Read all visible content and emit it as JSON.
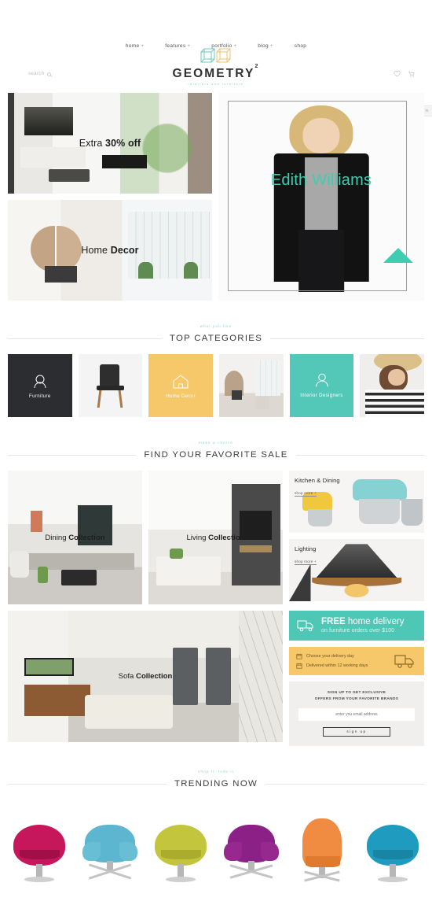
{
  "header": {
    "search_placeholder": "search",
    "brand_name": "GEOMETRY",
    "brand_sup": "2",
    "brand_tagline": "interiors and furniture",
    "icons": {
      "wishlist": "heart-icon",
      "cart": "cart-icon"
    },
    "side_tab_label": "in",
    "nav": [
      {
        "label": "home",
        "caret": "+"
      },
      {
        "label": "features",
        "caret": "+"
      },
      {
        "label": "portfolio",
        "caret": "+"
      },
      {
        "label": "blog",
        "caret": "+"
      },
      {
        "label": "shop",
        "caret": ""
      }
    ]
  },
  "hero": {
    "tile1": {
      "pre": "Extra ",
      "strong": "30% off"
    },
    "tile2": {
      "pre": "Home ",
      "strong": "Decor"
    },
    "feature": {
      "name": "Edith Williams",
      "accent": "#3ecdb0"
    }
  },
  "categories_section": {
    "sub_label": "what you like",
    "title": "TOP CATEGORIES",
    "items": [
      {
        "label": "Furniture",
        "icon": "lamp-icon",
        "style": "dark"
      },
      {
        "label": "",
        "icon": "chair-photo",
        "style": "light"
      },
      {
        "label": "Home Decor",
        "icon": "house-icon",
        "style": "amber"
      },
      {
        "label": "",
        "icon": "room-photo",
        "style": "photo"
      },
      {
        "label": "Interior Designers",
        "icon": "person-icon",
        "style": "teal"
      },
      {
        "label": "",
        "icon": "model-photo",
        "style": "photo"
      }
    ]
  },
  "sale_section": {
    "sub_label": "make a choice",
    "title": "FIND YOUR FAVORITE SALE",
    "tiles": [
      {
        "pre": "Dining ",
        "strong": "Collection"
      },
      {
        "pre": "Living ",
        "strong": "Collection"
      },
      {
        "pre": "Sofa ",
        "strong": "Collection"
      }
    ],
    "promos": [
      {
        "title": "Kitchen & Dining",
        "link": "shop more +"
      },
      {
        "title": "Lighting",
        "link": "shop more +"
      }
    ]
  },
  "delivery": {
    "headline_strong": "FREE",
    "headline_rest": " home delivery",
    "subline": "on furniture orders over $100",
    "truck_icon": "delivery-truck-icon",
    "options": [
      {
        "icon": "calendar-icon",
        "text": "Choose your delivery day"
      },
      {
        "icon": "calendar-icon",
        "text": "Delivered within 12 working days"
      }
    ]
  },
  "newsletter": {
    "line1": "SIGN UP TO GET EXCLUSIVE",
    "line2": "OFFERS FROM YOUR FAVORITE BRANDS",
    "input_placeholder": "enter you email address",
    "input_value": "",
    "button_label": "sign up"
  },
  "trending_section": {
    "sub_label": "shop it, love it",
    "title": "TRENDING NOW",
    "chairs": [
      {
        "name": "ball-chair-magenta",
        "color": "#c7175c"
      },
      {
        "name": "swan-chair-blue",
        "color": "#5cb6cf"
      },
      {
        "name": "ball-chair-olive",
        "color": "#c3c63c"
      },
      {
        "name": "swan-chair-purple",
        "color": "#8b2186"
      },
      {
        "name": "egg-chair-orange",
        "color": "#ef8c42"
      },
      {
        "name": "ball-chair-teal",
        "color": "#1e9bbf"
      }
    ]
  },
  "theme": {
    "accent_teal": "#4fc7b6",
    "accent_amber": "#f7c869",
    "dark": "#2b2d31",
    "text": "#3a3a3a"
  }
}
